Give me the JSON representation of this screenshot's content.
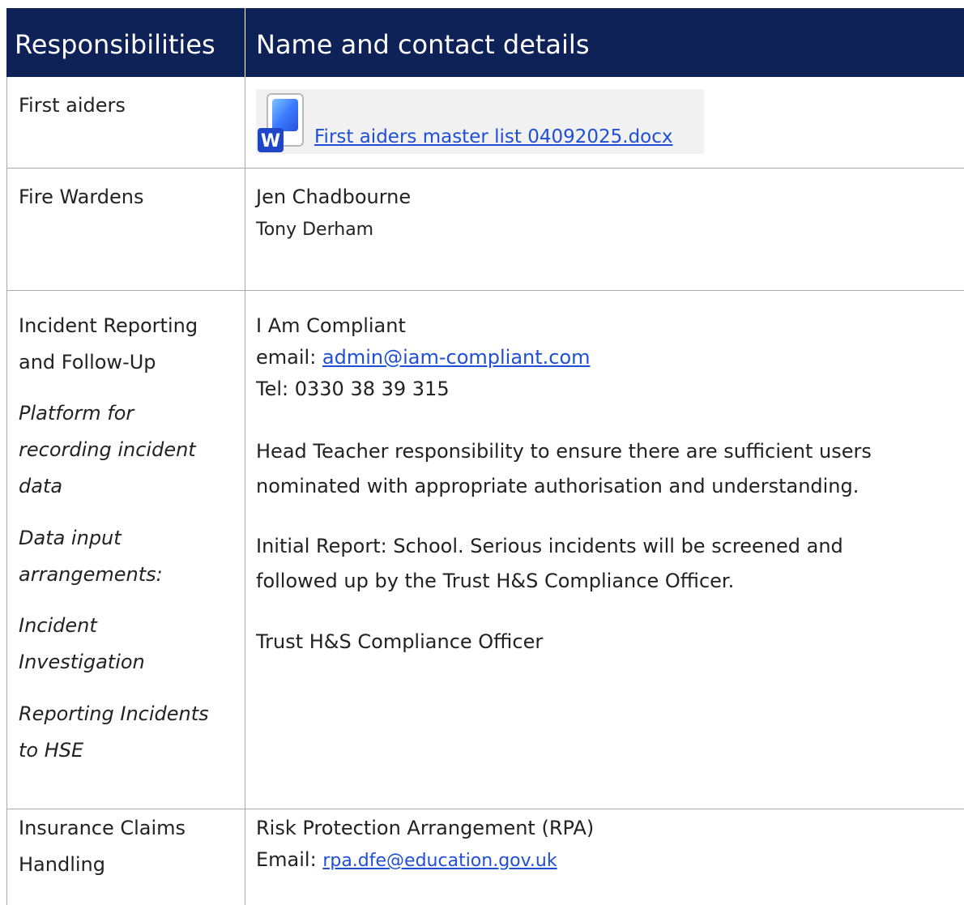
{
  "header": {
    "col1": "Responsibilities",
    "col2": "Name and contact details"
  },
  "rows": {
    "first_aiders": {
      "label": "First aiders",
      "attachment": "First aiders master list 04092025.docx",
      "attachment_icon": "word-document-icon"
    },
    "fire_wardens": {
      "label": "Fire Wardens",
      "name1": "Jen Chadbourne",
      "name2": "Tony Derham"
    },
    "incident": {
      "label_line1": "Incident      Reporting",
      "label_line2": "and Follow-Up",
      "sub1_line1": "Platform for",
      "sub1_line2": "recording incident",
      "sub1_line3": "data",
      "sub2_line1": "Data input",
      "sub2_line2": "arrangements:",
      "sub3_line1": "Incident",
      "sub3_line2": "Investigation",
      "sub4_line1": "Reporting Incidents",
      "sub4_line2": "to HSE",
      "company": "I Am Compliant",
      "email_label": "email: ",
      "email": "admin@iam-compliant.com",
      "tel": "Tel: 0330 38 39 315",
      "para1_line1": "Head Teacher responsibility to ensure there are sufficient users",
      "para1_line2": "nominated with appropriate authorisation and understanding.",
      "para2_line1": "Initial Report: School.  Serious incidents will be screened and",
      "para2_line2": "followed up by the Trust H&S Compliance Officer.",
      "para3": "Trust H&S Compliance Officer"
    },
    "insurance": {
      "label_line1": "Insurance Claims",
      "label_line2": "Handling",
      "org": "Risk Protection Arrangement (RPA)",
      "email_label": "Email: ",
      "email": "rpa.dfe@education.gov.uk"
    }
  },
  "colors": {
    "header_bg": "#0f2257",
    "link": "#1f4fd6",
    "border": "#a9a9a9"
  }
}
